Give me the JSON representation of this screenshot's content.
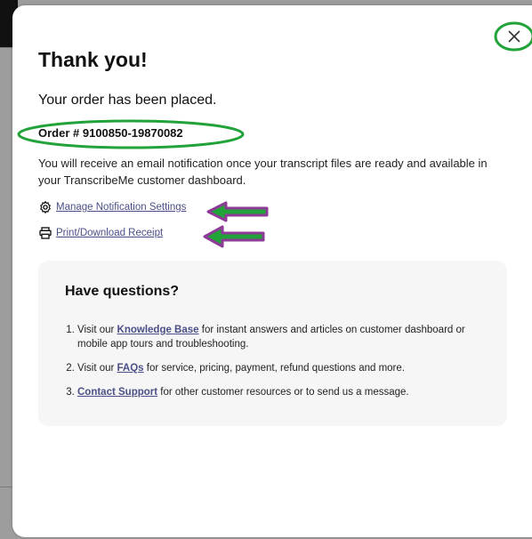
{
  "modal": {
    "title": "Thank you!",
    "subtitle": "Your order has been placed.",
    "order_number": "Order # 9100850-19870082",
    "notice": "You will receive an email notification once your transcript files are ready and available in your TranscribeMe customer dashboard.",
    "close_icon": "close-icon"
  },
  "links": {
    "settings": {
      "label": "Manage Notification Settings",
      "icon": "gear-icon"
    },
    "receipt": {
      "label": "Print/Download Receipt",
      "icon": "printer-icon"
    }
  },
  "questions": {
    "heading": "Have questions?",
    "items": [
      {
        "number": "1.",
        "prefix": "Visit our ",
        "link": "Knowledge Base",
        "suffix": " for instant answers and articles on customer dashboard or mobile app tours and troubleshooting."
      },
      {
        "number": "2.",
        "prefix": "Visit our ",
        "link": "FAQs",
        "suffix": " for service, pricing, payment, refund questions and more."
      },
      {
        "number": "3.",
        "prefix": "",
        "link": "Contact Support",
        "suffix": " for other customer resources or to send us a message."
      }
    ]
  },
  "annotations": {
    "ellipse_color": "#22a33a",
    "arrow_fill": "#22a33a",
    "arrow_stroke": "#8e3a97"
  }
}
